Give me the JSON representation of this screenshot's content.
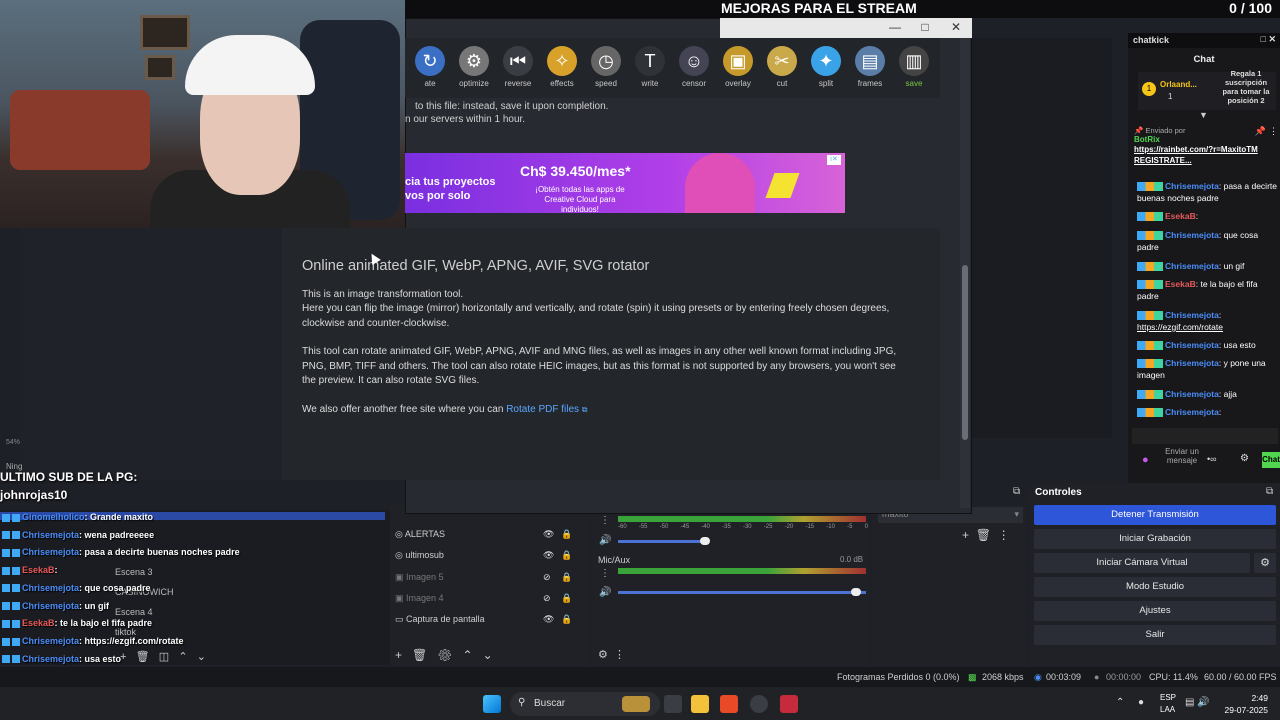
{
  "banner": {
    "title": "MEJORAS PARA EL STREAM",
    "count": "0  / 100"
  },
  "window": {
    "minimize": "—",
    "maximize": "□",
    "close": "✕"
  },
  "toolbar": [
    {
      "label": "ate",
      "icon": "rotate-icon",
      "glyph": "↻"
    },
    {
      "label": "optimize",
      "icon": "optimize-gear-icon",
      "glyph": "⚙"
    },
    {
      "label": "reverse",
      "icon": "reverse-icon",
      "glyph": "⏮"
    },
    {
      "label": "effects",
      "icon": "effects-icon",
      "glyph": "✧"
    },
    {
      "label": "speed",
      "icon": "speed-icon",
      "glyph": "◷"
    },
    {
      "label": "write",
      "icon": "write-icon",
      "glyph": "T"
    },
    {
      "label": "censor",
      "icon": "censor-icon",
      "glyph": "☺"
    },
    {
      "label": "overlay",
      "icon": "overlay-icon",
      "glyph": "▣"
    },
    {
      "label": "cut",
      "icon": "cut-icon",
      "glyph": "✂"
    },
    {
      "label": "split",
      "icon": "split-icon",
      "glyph": "✦"
    },
    {
      "label": "frames",
      "icon": "frames-icon",
      "glyph": "▤"
    },
    {
      "label": "save",
      "icon": "save-icon",
      "glyph": "▥"
    }
  ],
  "notice": {
    "line1": "to this file: instead, save it upon completion.",
    "line2": "n our servers within 1 hour."
  },
  "ad": {
    "left": "cia tus proyectos vos por solo",
    "price": "Ch$ 39.450/mes*",
    "sub": "¡Obtén todas las apps de Creative Cloud para individuos!"
  },
  "page": {
    "heading": "Online animated GIF, WebP, APNG, AVIF, SVG rotator",
    "p1": "This is an image transformation tool.",
    "p2": "Here you can flip the image (mirror) horizontally and vertically, and rotate (spin) it using presets or by entering freely chosen degrees, clockwise and counter-clockwise.",
    "p3": "This tool can rotate animated GIF, WebP, APNG, AVIF and MNG files, as well as images in any other well known format including JPG, PNG, BMP, TIFF and others. The tool can also rotate HEIC images, but as this format is not supported by any browsers, you won't see the preview. It can also rotate SVG files.",
    "p4_prefix": "We also offer another free site where you can ",
    "p4_link": "Rotate PDF files"
  },
  "left_overlay": {
    "pct": "54%",
    "ning": "Ning",
    "sub_title": "ULTIMO SUB DE LA PG:",
    "sub_name": "johnrojas10"
  },
  "chat_left": [
    {
      "name": "Ginomelholico",
      "text": "Grande maxito",
      "red": false
    },
    {
      "name": "Chrisemejota",
      "text": "wena padreeeee",
      "red": false
    },
    {
      "name": "Chrisemejota",
      "text": "pasa a decirte buenas noches padre",
      "red": false
    },
    {
      "name": "EsekaB",
      "text": "",
      "red": true
    },
    {
      "name": "Chrisemejota",
      "text": "que cosa padre",
      "red": false
    },
    {
      "name": "Chrisemejota",
      "text": "un gif",
      "red": false
    },
    {
      "name": "EsekaB",
      "text": "te la bajo el fifa padre",
      "red": true
    },
    {
      "name": "Chrisemejota",
      "text": "https://ezgif.com/rotate",
      "red": false
    },
    {
      "name": "Chrisemejota",
      "text": "usa esto",
      "red": false
    },
    {
      "name": "Chrisemejota",
      "text": "y pone una imagen",
      "red": false
    },
    {
      "name": "Chrisemejota",
      "text": "ajja",
      "red": false
    },
    {
      "name": "Chrisemejota",
      "text": "",
      "red": false
    }
  ],
  "scenes": [
    "Escena 3",
    "CASINOWICH",
    "Escena 4",
    "tiktok"
  ],
  "sources": [
    {
      "name": "ALERTAS",
      "dim": false
    },
    {
      "name": "ultimosub",
      "dim": false
    },
    {
      "name": "Imagen 5",
      "dim": true
    },
    {
      "name": "Imagen 4",
      "dim": true
    },
    {
      "name": "Captura de pantalla",
      "dim": false
    }
  ],
  "mixer": {
    "mic_label": "Mic/Aux",
    "mic_db": "0.0 dB",
    "ticks": [
      "-60",
      "-55",
      "-50",
      "-45",
      "-40",
      "-35",
      "-30",
      "-25",
      "-20",
      "-15",
      "-10",
      "-5",
      "0"
    ]
  },
  "transition": {
    "selected": "maxito"
  },
  "controls": {
    "title": "Controles",
    "stop": "Detener Transmisión",
    "record": "Iniciar Grabación",
    "virtualcam": "Iniciar Cámara Virtual",
    "studio": "Modo Estudio",
    "settings": "Ajustes",
    "exit": "Salir"
  },
  "status": {
    "dropped": "Fotogramas Perdidos 0 (0.0%)",
    "kbps": "2068 kbps",
    "time_live": "00:03:09",
    "time_rec": "00:00:00",
    "cpu": "CPU: 11.4%",
    "fps": "60.00 / 60.00 FPS"
  },
  "taskbar": {
    "search": "Buscar",
    "lang1": "ESP",
    "lang2": "LAA",
    "time": "2:49",
    "date": "29-07-2025"
  },
  "chat_right": {
    "head": "chatkick",
    "label": "Chat",
    "gift_user": "Orlaand...",
    "gift_count": "1",
    "gift_text": "Regala 1 suscripción para tomar la posición 2",
    "pinned_by": "Enviado por",
    "pinned_user": "BotRix",
    "pinned_link": "https://rainbet.com/?r=MaxitoTM REGISTRATE...",
    "send": "Enviar un mensaje",
    "chat_btn": "Chat",
    "messages": [
      {
        "name": "Chrisemejota",
        "text": "pasa a decirte buenas noches padre",
        "red": false
      },
      {
        "name": "EsekaB",
        "text": "",
        "red": true
      },
      {
        "name": "Chrisemejota",
        "text": "que cosa padre",
        "red": false
      },
      {
        "name": "Chrisemejota",
        "text": "un gif",
        "red": false
      },
      {
        "name": "EsekaB",
        "text": "te la bajo el fifa padre",
        "red": true
      },
      {
        "name": "Chrisemejota",
        "text": "https://ezgif.com/rotate",
        "red": false
      },
      {
        "name": "Chrisemejota",
        "text": "usa esto",
        "red": false
      },
      {
        "name": "Chrisemejota",
        "text": "y pone una imagen",
        "red": false
      },
      {
        "name": "Chrisemejota",
        "text": "ajja",
        "red": false
      },
      {
        "name": "Chrisemejota",
        "text": "",
        "red": false
      }
    ]
  }
}
